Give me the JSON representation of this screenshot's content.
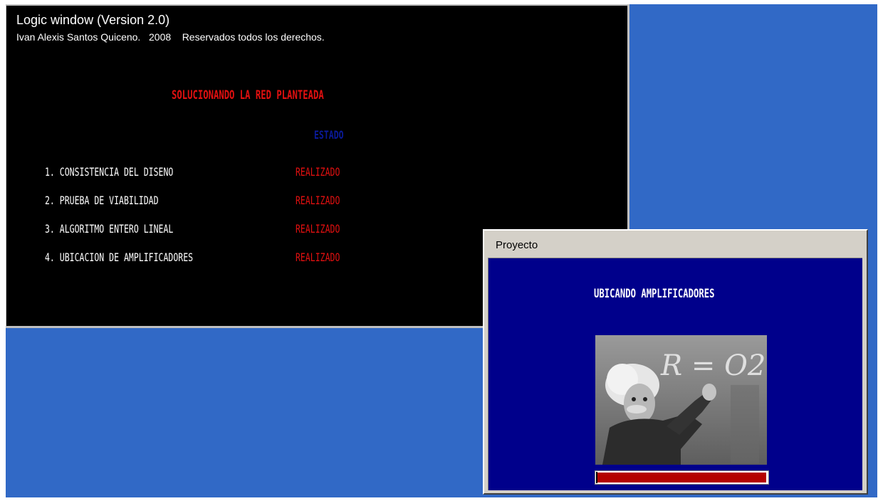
{
  "colors": {
    "desktop": "#3169c6",
    "terminal_bg": "#000000",
    "heading": "#e21010",
    "status_header": "#0a1a9a",
    "status_done": "#e21010",
    "dialog_body": "#00008b",
    "progress_fill": "#b40000"
  },
  "logic_window": {
    "title": "Logic window (Version 2.0)",
    "copyright": "Ivan Alexis Santos Quiceno.   2008    Reservados todos los derechos.",
    "heading": "SOLUCIONANDO LA RED PLANTEADA",
    "status_header": "ESTADO",
    "steps": [
      {
        "label": "1. CONSISTENCIA DEL DISENO",
        "status": "REALIZADO"
      },
      {
        "label": "2. PRUEBA DE VIABILIDAD",
        "status": "REALIZADO"
      },
      {
        "label": "3. ALGORITMO ENTERO LINEAL",
        "status": "REALIZADO"
      },
      {
        "label": "4. UBICACION DE AMPLIFICADORES",
        "status": "REALIZADO"
      }
    ]
  },
  "proyecto_dialog": {
    "title": "Proyecto",
    "message": "UBICANDO AMPLIFICADORES",
    "chalkboard_text": "R  = O2",
    "progress_fraction": 1.0
  }
}
